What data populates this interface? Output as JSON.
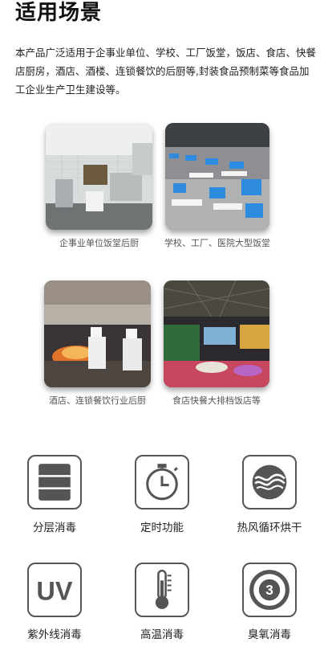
{
  "title": "适用场景",
  "intro": "本产品广泛适用于企事业单位、学校、工厂饭堂，饭店、食店、快餐店厨房，酒店、酒楼、连锁餐饮的后厨等,封装食品预制菜等食品加工企业生产卫生建设等。",
  "scenes": [
    {
      "caption": "企事业单位饭堂后厨",
      "image": "kitchen-photo"
    },
    {
      "caption": "学校、工厂、医院大型饭堂",
      "image": "canteen-photo"
    },
    {
      "caption": "酒店、连锁餐饮行业后厨",
      "image": "chefs-cooking-photo"
    },
    {
      "caption": "食店快餐大排档饭店等",
      "image": "night-market-photo"
    }
  ],
  "features": [
    {
      "label": "分层消毒",
      "icon": "layers-icon"
    },
    {
      "label": "定时功能",
      "icon": "timer-icon"
    },
    {
      "label": "热风循环烘干",
      "icon": "hot-air-icon"
    },
    {
      "label": "紫外线消毒",
      "icon": "uv-icon",
      "icon_text": "UV"
    },
    {
      "label": "高温消毒",
      "icon": "thermometer-icon"
    },
    {
      "label": "臭氧消毒",
      "icon": "ozone-icon",
      "icon_text": "3"
    }
  ],
  "colors": {
    "icon_stroke": "#555555",
    "text": "#222222",
    "caption": "#555555"
  }
}
